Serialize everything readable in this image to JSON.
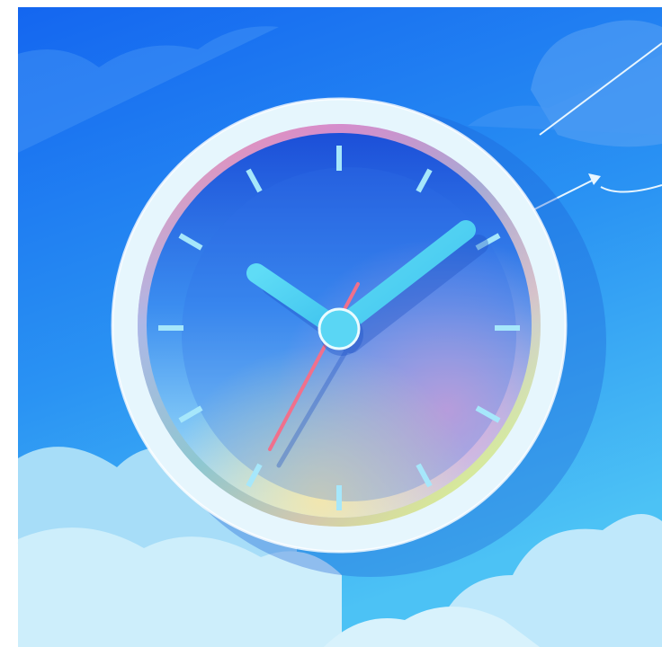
{
  "illustration": {
    "subject": "clock-icon",
    "colors": {
      "sky_top": "#1a6cf2",
      "sky_bottom": "#43b9f4",
      "cloud_light": "#c9ecfb",
      "cloud_mid": "#9bd8f8",
      "cloud_back": "#5fa6f4",
      "bezel": "#e9f7fd",
      "dial_top": "#1f5ee0",
      "dial_bottom": "#8fd3f6",
      "hands": "#55d2f3",
      "second_hand": "#f0708c",
      "ticks": "#9fe3fb",
      "rim_rainbow": [
        "#f9919c",
        "#c48cf3",
        "#7fa6f6",
        "#f5a6c9",
        "#fbe39a",
        "#9ff0c8",
        "#a9ee8c"
      ]
    },
    "clock_time": {
      "hour_hand_angle_deg": 300,
      "minute_hand_angle_deg": 55,
      "second_hand_angle_deg": 205
    }
  }
}
